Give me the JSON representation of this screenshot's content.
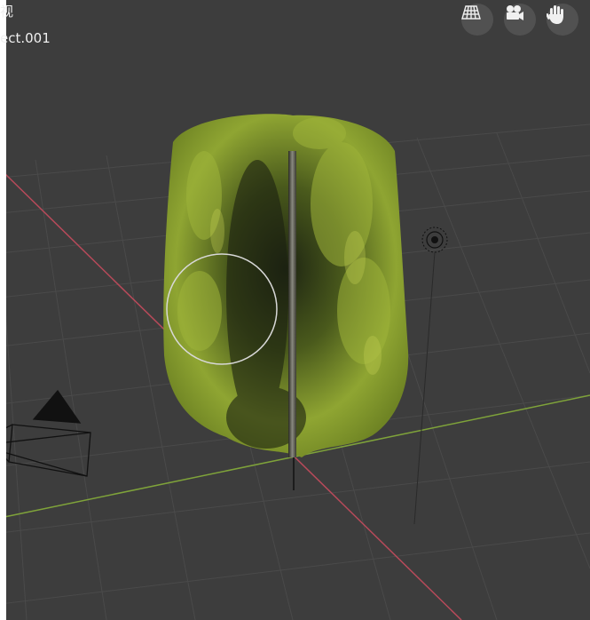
{
  "viewport": {
    "header_line_1": "视",
    "header_line_2": "ect.001",
    "toolbar": [
      {
        "name": "grid-view-icon"
      },
      {
        "name": "camera-view-icon"
      },
      {
        "name": "hand-pan-icon"
      }
    ]
  },
  "scene_objects": [
    "willow-tree",
    "camera-object",
    "light-object",
    "3d-cursor"
  ],
  "colors": {
    "background": "#3d3d3d",
    "grid_line": "#4a4a4a",
    "x_axis": "#b84a5a",
    "y_axis": "#7fa33a",
    "foliage_light": "#a2b53b",
    "foliage_dark": "#1e2512"
  }
}
